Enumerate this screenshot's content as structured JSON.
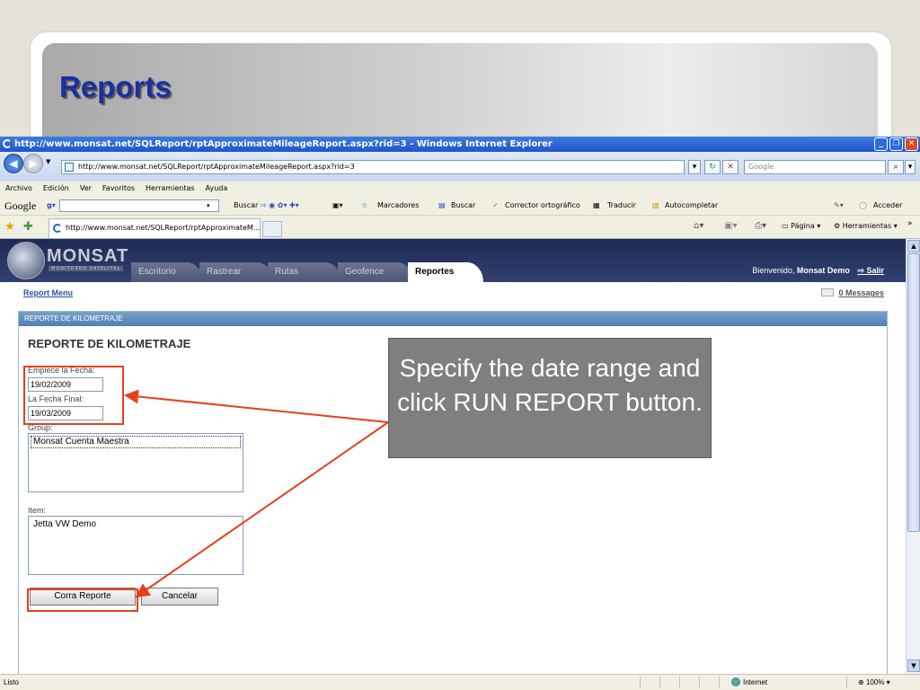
{
  "slide": {
    "title": "Reports",
    "callout": "Specify the date range and click RUN REPORT button."
  },
  "browser": {
    "window_title": "http://www.monsat.net/SQLReport/rptApproximateMileageReport.aspx?rid=3 - Windows Internet Explorer",
    "url": "http://www.monsat.net/SQLReport/rptApproximateMileageReport.aspx?rid=3",
    "search_placeholder": "Google",
    "menu": [
      "Archivo",
      "Edición",
      "Ver",
      "Favoritos",
      "Herramientas",
      "Ayuda"
    ],
    "google_toolbar": {
      "logo": "Google",
      "buscar": "Buscar",
      "marcadores": "Marcadores",
      "buscar2": "Buscar",
      "corrector": "Corrector ortográfico",
      "traducir": "Traducir",
      "autocompletar": "Autocompletar",
      "acceder": "Acceder"
    },
    "tab_label": "http://www.monsat.net/SQLReport/rptApproximateM...",
    "command_bar": {
      "pagina": "Página",
      "herramientas": "Herramientas"
    },
    "status": {
      "text": "Listo",
      "zone": "Internet",
      "zoom": "100%"
    }
  },
  "app": {
    "logo_text": "MONSAT",
    "logo_subtitle": "MONITOREO SATELITAL",
    "tabs": [
      "Escritorio",
      "Rastrear",
      "Rutas",
      "Geofence",
      "Reportes"
    ],
    "active_tab": "Reportes",
    "welcome_prefix": "Bienvenido,",
    "user_name": "Monsat Demo",
    "logout": "Salir",
    "report_menu": "Report Menu",
    "messages": "0 Messages"
  },
  "form": {
    "panel_title": "REPORTE DE KILOMETRAJE",
    "heading": "REPORTE DE KILOMETRAJE",
    "start_label": "Empiece la Fecha:",
    "start_value": "19/02/2009",
    "end_label": "La Fecha Final:",
    "end_value": "19/03/2009",
    "group_label": "Group:",
    "group_options": [
      "Monsat Cuenta Maestra"
    ],
    "item_label": "Item:",
    "item_options": [
      "Jetta VW Demo"
    ],
    "run_button": "Corra Reporte",
    "cancel_button": "Cancelar"
  },
  "colors": {
    "title_blue": "#1a2fa0",
    "highlight": "#e6401a",
    "callout_bg": "#7f7f7f"
  }
}
